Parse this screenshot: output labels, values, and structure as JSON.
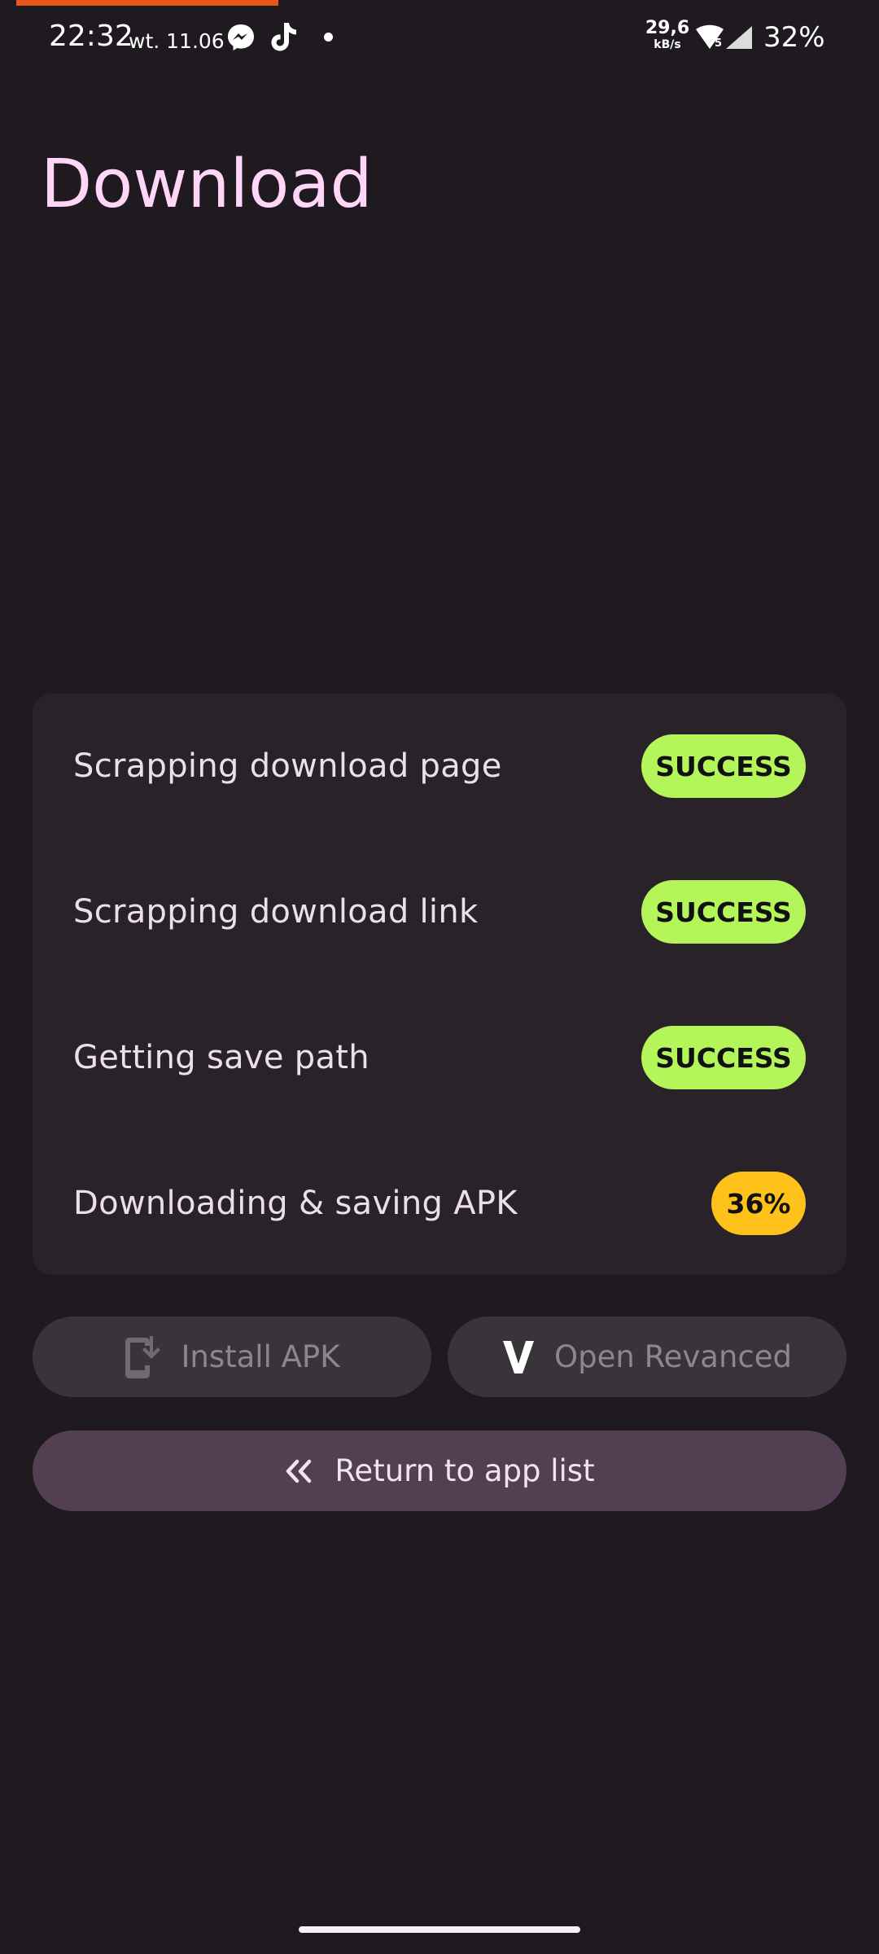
{
  "status_bar": {
    "time": "22:32",
    "date": "wt. 11.06",
    "net_speed_value": "29,6",
    "net_speed_unit": "kB/s",
    "wifi_badge": "5",
    "battery": "32%",
    "notification_icons": [
      "messenger-icon",
      "tiktok-icon",
      "more-notifications-dot"
    ],
    "accent_color": "#e8561a"
  },
  "page": {
    "title": "Download",
    "title_color": "#ffd6f8"
  },
  "steps": [
    {
      "label": "Scrapping download page",
      "status": "SUCCESS",
      "status_color": "#b4f55a"
    },
    {
      "label": "Scrapping download link",
      "status": "SUCCESS",
      "status_color": "#b4f55a"
    },
    {
      "label": "Getting save path",
      "status": "SUCCESS",
      "status_color": "#b4f55a"
    },
    {
      "label": "Downloading & saving APK",
      "status": "36%",
      "status_color": "#ffc21a"
    }
  ],
  "actions": {
    "install_label": "Install APK",
    "install_icon": "install-phone-icon",
    "open_label": "Open Revanced",
    "open_icon": "revanced-logo-icon",
    "return_label": "Return to app list",
    "return_icon": "double-chevron-left-icon"
  }
}
